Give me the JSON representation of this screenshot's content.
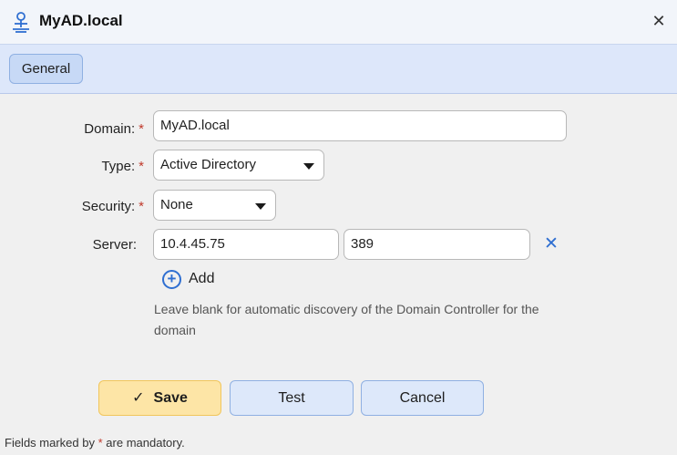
{
  "dialog": {
    "title": "MyAD.local",
    "icon": "network-domain-icon",
    "close_glyph": "✕"
  },
  "tabs": [
    {
      "label": "General",
      "selected": true
    }
  ],
  "form": {
    "required_marker": "*",
    "domain": {
      "label": "Domain:",
      "value": "MyAD.local",
      "required": true
    },
    "type": {
      "label": "Type:",
      "value": "Active Directory",
      "required": true
    },
    "security": {
      "label": "Security:",
      "value": "None",
      "required": true
    },
    "server": {
      "label": "Server:",
      "host": "10.4.45.75",
      "port": "389",
      "remove_glyph": "✕"
    },
    "add_label": "Add",
    "hint": "Leave blank for automatic discovery of the Domain Controller for the domain"
  },
  "buttons": {
    "save": "Save",
    "test": "Test",
    "cancel": "Cancel"
  },
  "footer": {
    "prefix": "Fields marked by",
    "marker": "*",
    "suffix": "are mandatory."
  },
  "colors": {
    "accent": "#2f6fd1",
    "required": "#c0392b",
    "save_bg": "#fde5a6",
    "tab_bar_bg": "#dde7fa"
  }
}
